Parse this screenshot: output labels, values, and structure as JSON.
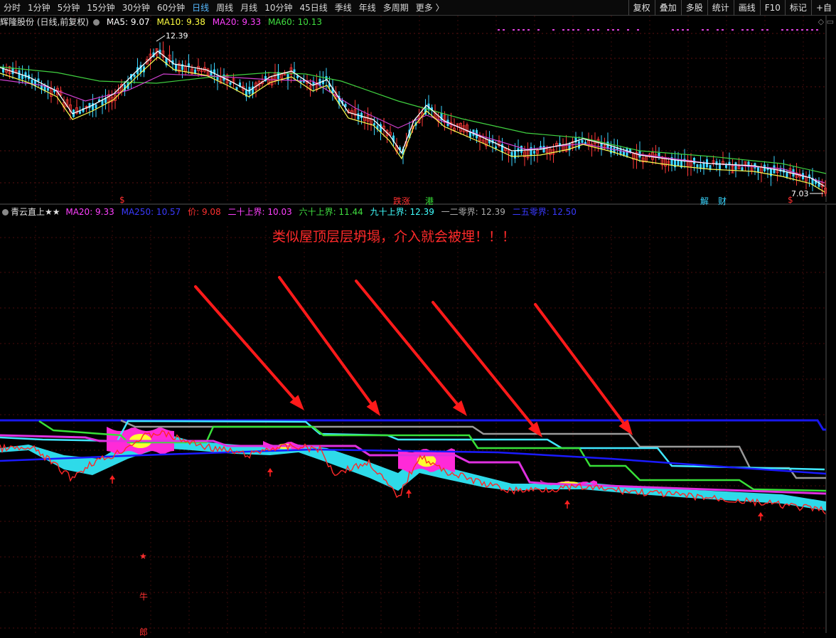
{
  "toolbar": {
    "periods": [
      "分时",
      "1分钟",
      "5分钟",
      "15分钟",
      "30分钟",
      "60分钟",
      "日线",
      "周线",
      "月线",
      "10分钟",
      "45日线",
      "季线",
      "年线",
      "多周期",
      "更多 〉"
    ],
    "active_period": "日线",
    "right_buttons": [
      "复权",
      "叠加",
      "多股",
      "统计",
      "画线",
      "F10",
      "标记",
      "+自"
    ]
  },
  "main_legend": {
    "stock": "辉隆股份 (日线,前复权)",
    "ma5": "MA5: 9.07",
    "ma10": "MA10: 9.38",
    "ma20": "MA20: 9.33",
    "ma60": "MA60: 10.13"
  },
  "main_chart": {
    "high_label": "12.39",
    "low_label": "7.03",
    "event_markers": [
      {
        "text": "$",
        "color": "#ff3030"
      },
      {
        "text": "跌涨",
        "color": "#ff3030"
      },
      {
        "text": "港",
        "color": "#39e639"
      },
      {
        "text": "解",
        "color": "#39d6ff"
      },
      {
        "text": "财",
        "color": "#39d6ff"
      },
      {
        "text": "$",
        "color": "#ff3030"
      }
    ]
  },
  "indicator_legend": {
    "name": "青云直上★★",
    "ma20": "MA20: 9.33",
    "ma250": "MA250: 10.57",
    "price": "价: 9.08",
    "l20": "二十上界: 10.03",
    "l60": "六十上界: 11.44",
    "l90": "九十上界: 12.39",
    "l120": "一二零界: 12.39",
    "l250": "二五零界: 12.50"
  },
  "annotation": "类似屋顶层层坍塌，介入就会被埋！！！",
  "bottom_markers": [
    "★",
    "牛",
    "郎"
  ],
  "colors": {
    "ma5": "#ffffff",
    "ma10": "#ffff40",
    "ma20": "#ff40ff",
    "ma60": "#40e040",
    "ma250": "#2222ff",
    "price": "#ff3030",
    "l20": "#ff40ff",
    "l60": "#40e040",
    "l90": "#40ffff",
    "l120": "#aaaaaa",
    "l250": "#1a1aff",
    "arrow": "#ff2020"
  }
}
